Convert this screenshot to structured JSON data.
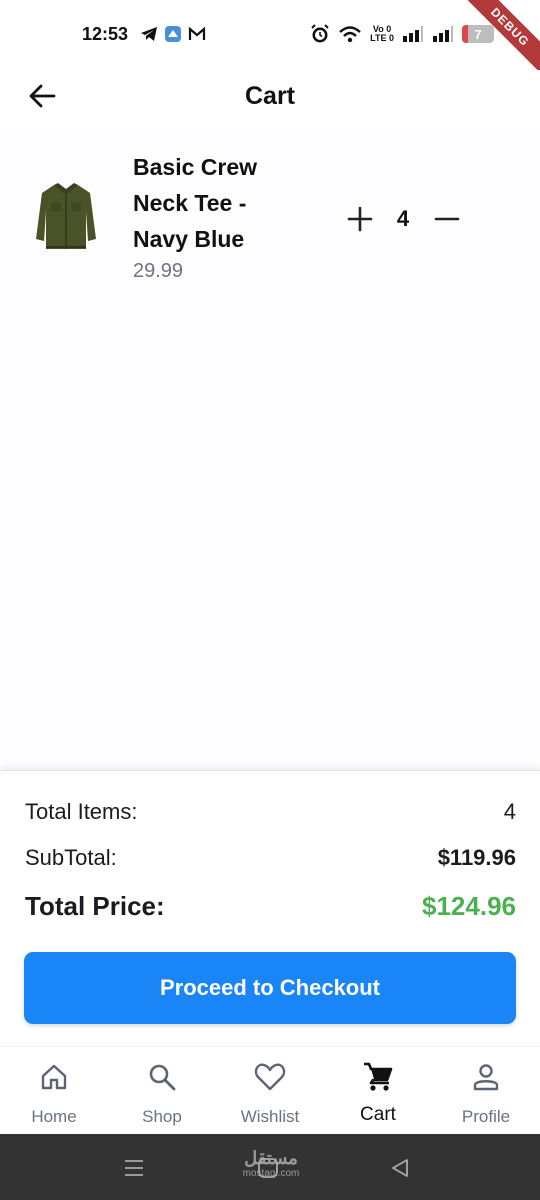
{
  "status_bar": {
    "time": "12:53",
    "net_label_top": "Vo 0",
    "net_label_bottom": "LTE 0",
    "battery": "7",
    "debug_label": "DEBUG"
  },
  "header": {
    "title": "Cart"
  },
  "cart": {
    "items": [
      {
        "name": "Basic Crew Neck Tee - Navy Blue",
        "price": "29.99",
        "quantity": "4",
        "image": "olive-jacket"
      }
    ]
  },
  "summary": {
    "total_items_label": "Total Items:",
    "total_items_value": "4",
    "subtotal_label": "SubTotal:",
    "subtotal_value": "$119.96",
    "total_price_label": "Total Price:",
    "total_price_value": "$124.96",
    "checkout_label": "Proceed to Checkout"
  },
  "nav": {
    "items": [
      {
        "label": "Home",
        "icon": "home-icon"
      },
      {
        "label": "Shop",
        "icon": "search-icon"
      },
      {
        "label": "Wishlist",
        "icon": "heart-icon"
      },
      {
        "label": "Cart",
        "icon": "cart-icon",
        "active": true
      },
      {
        "label": "Profile",
        "icon": "person-icon"
      }
    ]
  },
  "watermark": {
    "main": "مستقل",
    "sub": "mostaql.com"
  },
  "colors": {
    "accent": "#1a85f7",
    "total_price": "#4caf50",
    "muted_text": "#6b7280"
  }
}
